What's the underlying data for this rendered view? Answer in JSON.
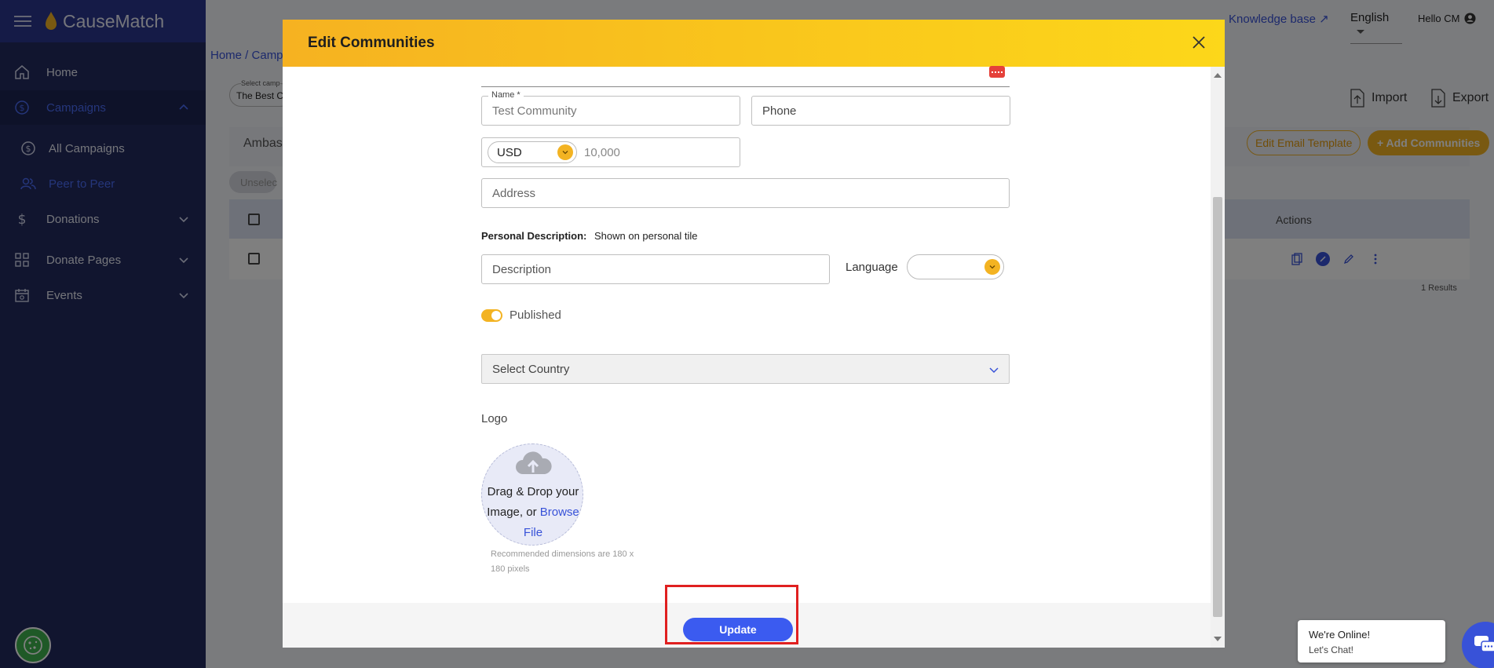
{
  "app": {
    "brand": "CauseMatch"
  },
  "sidebar": {
    "items": [
      {
        "label": "Home",
        "icon": "home-icon"
      },
      {
        "label": "Campaigns",
        "icon": "dollar-circle-icon",
        "active": true
      },
      {
        "label": "All Campaigns",
        "icon": "dollar-circle-icon"
      },
      {
        "label": "Peer to Peer",
        "icon": "users-icon",
        "current": true
      },
      {
        "label": "Donations",
        "icon": "dollar-icon"
      },
      {
        "label": "Donate Pages",
        "icon": "grid-icon"
      },
      {
        "label": "Events",
        "icon": "calendar-icon"
      }
    ]
  },
  "header": {
    "knowledge_base": "Knowledge base ↗",
    "language": "English",
    "greeting": "Hello CM"
  },
  "page": {
    "breadcrumb": "Home  /  Camp",
    "campaign_select_small": "Select camp",
    "campaign_select_value": "The Best C",
    "import_label": "Import",
    "export_label": "Export",
    "tab_ambassadors": "Ambassa",
    "edit_email_template": "Edit Email Template",
    "add_communities": "+ Add Communities",
    "unselect": "Unselec",
    "actions_header": "Actions",
    "results": "1 Results"
  },
  "modal": {
    "title": "Edit Communities",
    "name_label": "Name *",
    "name_value": "Test Community",
    "phone_placeholder": "Phone",
    "currency": "USD",
    "goal_value": "10,000",
    "address_placeholder": "Address",
    "personal_description_label": "Personal Description:",
    "personal_description_hint": "Shown on personal tile",
    "description_placeholder": "Description",
    "language_label": "Language",
    "published_label": "Published",
    "published": true,
    "country_placeholder": "Select Country",
    "logo_label": "Logo",
    "dropzone_text": "Drag & Drop your Image, or",
    "dropzone_link": "Browse File",
    "recommended": "Recommended dimensions are 180 x 180 pixels",
    "update_button": "Update"
  },
  "chat": {
    "status": "We're Online!",
    "cta": "Let's Chat!"
  },
  "colors": {
    "sidebar_bg": "#222a5e",
    "accent_blue": "#3b5bf0",
    "accent_yellow": "#f3b322",
    "highlight_red": "#e02020"
  }
}
